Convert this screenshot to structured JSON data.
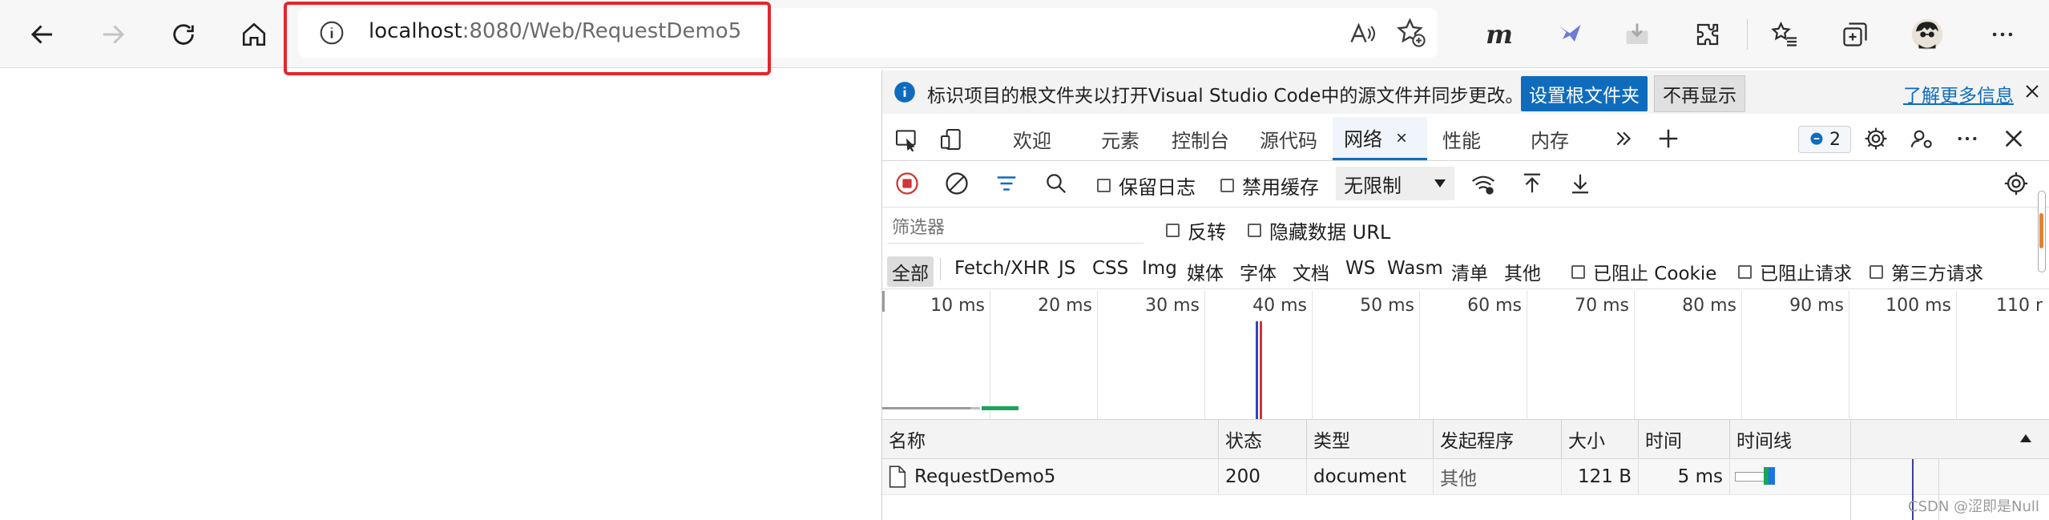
{
  "browser": {
    "url_host": "localhost",
    "url_rest": ":8080/Web/RequestDemo5"
  },
  "devtools": {
    "infobar": {
      "text": "标识项目的根文件夹以打开Visual Studio Code中的源文件并同步更改。",
      "set_root_button": "设置根文件夹",
      "dont_show_button": "不再显示",
      "learn_more_link": "了解更多信息"
    },
    "tabs": [
      {
        "label": "欢迎"
      },
      {
        "label": "元素"
      },
      {
        "label": "控制台"
      },
      {
        "label": "源代码"
      },
      {
        "label": "网络",
        "active": true
      },
      {
        "label": "性能"
      },
      {
        "label": "内存"
      }
    ],
    "issues_count": "2",
    "toolbar": {
      "preserve_log": "保留日志",
      "disable_cache": "禁用缓存",
      "throttling": "无限制"
    },
    "filter": {
      "placeholder": "筛选器",
      "invert": "反转",
      "hide_data_url": "隐藏数据 URL"
    },
    "types": [
      "全部",
      "Fetch/XHR",
      "JS",
      "CSS",
      "Img",
      "媒体",
      "字体",
      "文档",
      "WS",
      "Wasm",
      "清单",
      "其他"
    ],
    "type_checks": {
      "blocked_cookies": "已阻止 Cookie",
      "blocked_requests": "已阻止请求",
      "third_party": "第三方请求"
    },
    "timeline_ticks": [
      "10 ms",
      "20 ms",
      "30 ms",
      "40 ms",
      "50 ms",
      "60 ms",
      "70 ms",
      "80 ms",
      "90 ms",
      "100 ms",
      "110 r"
    ],
    "table": {
      "headers": [
        "名称",
        "状态",
        "类型",
        "发起程序",
        "大小",
        "时间",
        "时间线"
      ],
      "rows": [
        {
          "name": "RequestDemo5",
          "status": "200",
          "type": "document",
          "initiator": "其他",
          "size": "121 B",
          "time": "5 ms"
        }
      ]
    }
  },
  "watermark": "CSDN @涩即是Null",
  "colors": {
    "accent": "#0f6cbd",
    "highlight_box": "#e3262b",
    "record": "#d13438"
  }
}
